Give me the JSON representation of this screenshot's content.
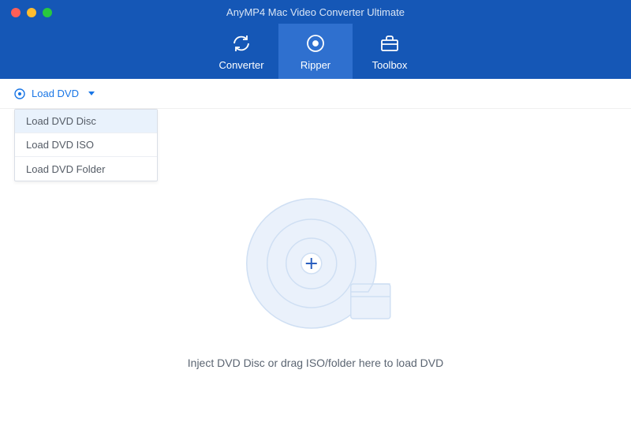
{
  "app": {
    "title": "AnyMP4 Mac Video Converter Ultimate"
  },
  "tabs": {
    "converter": "Converter",
    "ripper": "Ripper",
    "toolbox": "Toolbox"
  },
  "toolbar": {
    "load_label": "Load DVD"
  },
  "dropdown": {
    "items": [
      "Load DVD Disc",
      "Load DVD ISO",
      "Load DVD Folder"
    ]
  },
  "content": {
    "prompt": "Inject DVD Disc or drag ISO/folder here to load DVD"
  },
  "colors": {
    "accent": "#1557b6",
    "link": "#1976e6"
  }
}
